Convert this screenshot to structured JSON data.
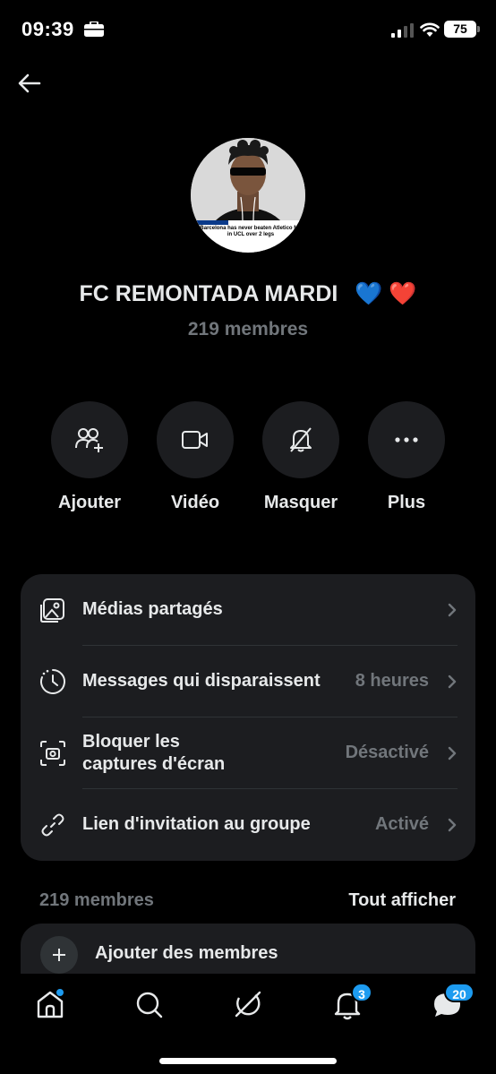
{
  "status_bar": {
    "time": "09:39",
    "battery": "75"
  },
  "group": {
    "title": "FC REMONTADA MARDI",
    "emojis": "💙 ❤️",
    "member_count": "219 membres",
    "avatar_caption_lines": [
      "Barcelona has never beaten Atletico Ma",
      "in UCL over 2 legs"
    ]
  },
  "actions": [
    {
      "label": "Ajouter",
      "icon": "add-people-icon"
    },
    {
      "label": "Vidéo",
      "icon": "video-camera-icon"
    },
    {
      "label": "Masquer",
      "icon": "bell-off-icon"
    },
    {
      "label": "Plus",
      "icon": "more-dots-icon"
    }
  ],
  "settings": [
    {
      "title": "Médias partagés",
      "value": "",
      "icon": "shared-media-icon"
    },
    {
      "title": "Messages qui disparaissent",
      "value": "8 heures",
      "icon": "timer-icon"
    },
    {
      "title_line1": "Bloquer les",
      "title_line2": "captures d'écran",
      "value": "Désactivé",
      "icon": "screenshot-camera-icon"
    },
    {
      "title": "Lien d'invitation au groupe",
      "value": "Activé",
      "icon": "link-icon"
    }
  ],
  "members_section": {
    "label": "219 membres",
    "see_all": "Tout afficher",
    "add_members": "Ajouter des membres"
  },
  "nav": {
    "notifications_badge": "3",
    "messages_badge": "20"
  },
  "colors": {
    "accent": "#1d9bf0",
    "card": "#1c1d20",
    "muted": "#71767b"
  }
}
